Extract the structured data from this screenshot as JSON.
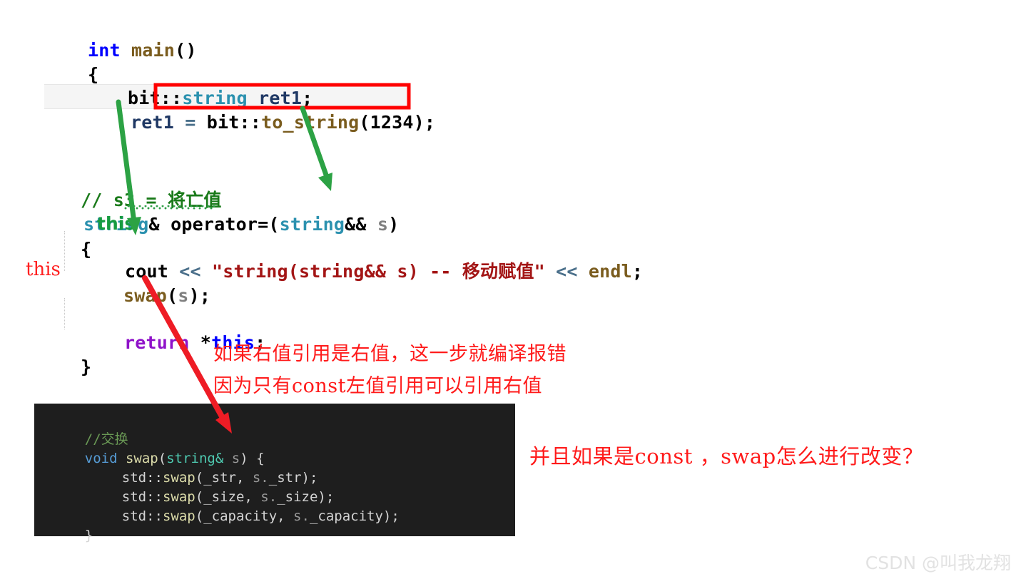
{
  "meta": {
    "watermark": "CSDN @叫我龙翔",
    "bg_color": "#ffffff",
    "dark_block_color": "#1e1e1e",
    "highlight_red": "#ff0000",
    "arrow_green": "#2ca244",
    "arrow_red": "#ee1c25"
  },
  "light_code": {
    "line1": {
      "kw": "int",
      "sp": " ",
      "fn": "main",
      "punct": "()"
    },
    "line2": {
      "text": "{"
    },
    "line3": {
      "ns": "bit::",
      "type": "string",
      "sp": " ",
      "var": "ret1",
      "punct": ";"
    },
    "line4": {
      "var": "ret1",
      "op": " = ",
      "ns": "bit::",
      "fn": "to_string",
      "punct": "(",
      "num": "1234",
      "tail": ");"
    },
    "line5": {
      "comment": "// s3 = 将亡值"
    },
    "line6": {
      "type": "string",
      "amp": "&",
      "sp": " ",
      "fn": "operator=",
      "p1": "(",
      "type2": "string",
      "amp2": "&&",
      "sp2": " ",
      "var": "s",
      "p2": ")"
    },
    "line7": {
      "text": "{"
    },
    "line8": {
      "fn": "cout",
      "op": " << ",
      "str": "\"string(string&& s) -- 移动赋值\"",
      "op2": " << ",
      "var": "endl",
      "punct": ";"
    },
    "line9": {
      "fn": "swap",
      "punct": "(",
      "var": "s",
      "tail": ");"
    },
    "line10": {
      "kw": "return",
      "sp": " ",
      "star": "*",
      "this": "this",
      "punct": ";"
    },
    "line11": {
      "text": "}"
    }
  },
  "annotations": {
    "green_this": "this",
    "red_this": "this",
    "note_line1": "如果右值引用是右值，这一步就编译报错",
    "note_line2": "因为只有const左值引用可以引用右值",
    "note_right": "并且如果是const ，swap怎么进行改变？"
  },
  "dark_code": {
    "line1": {
      "comment": "//交换"
    },
    "line2": {
      "kw": "void",
      "sp": " ",
      "fn": "swap",
      "p1": "(",
      "type": "string",
      "amp": "&",
      "sp2": " ",
      "var": "s",
      "p2": ") {"
    },
    "line3": {
      "ns": "std::",
      "fn": "swap",
      "p1": "(",
      "arg1": "_str",
      "comma": ", ",
      "obj": "s",
      "dot": ".",
      "arg2": "_str",
      "tail": ");"
    },
    "line4": {
      "ns": "std::",
      "fn": "swap",
      "p1": "(",
      "arg1": "_size",
      "comma": ", ",
      "obj": "s",
      "dot": ".",
      "arg2": "_size",
      "tail": ");"
    },
    "line5": {
      "ns": "std::",
      "fn": "swap",
      "p1": "(",
      "arg1": "_capacity",
      "comma": ", ",
      "obj": "s",
      "dot": ".",
      "arg2": "_capacity",
      "tail": ");"
    },
    "line6": {
      "text": "}"
    }
  }
}
